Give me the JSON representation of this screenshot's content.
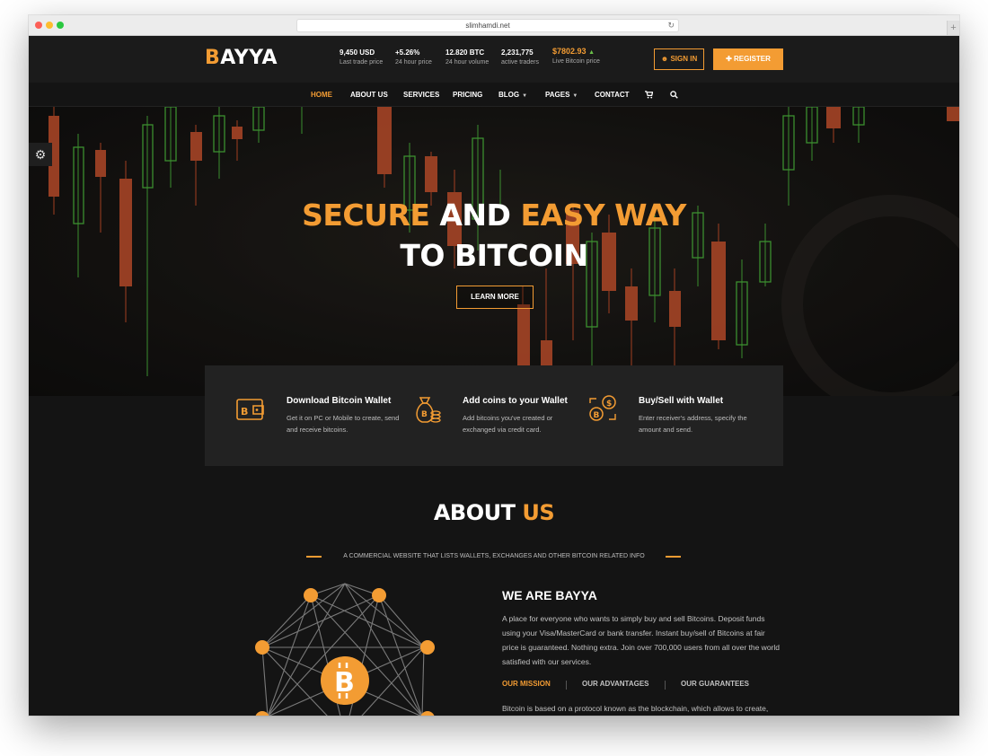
{
  "browser": {
    "url": "slimhamdi.net",
    "reload_icon": "reload-icon"
  },
  "brand": {
    "logo_initial": "B",
    "logo_rest": "AYYA"
  },
  "stats": [
    {
      "value": "9,450 USD",
      "label": "Last trade price"
    },
    {
      "value": "+5.26%",
      "label": "24 hour price"
    },
    {
      "value": "12.820 BTC",
      "label": "24 hour volume"
    },
    {
      "value": "2,231,775",
      "label": "active traders"
    },
    {
      "value": "$7802.93",
      "label": "Live Bitcoin price"
    }
  ],
  "auth": {
    "signin": "SIGN IN",
    "register": "REGISTER"
  },
  "nav": [
    "HOME",
    "ABOUT US",
    "SERVICES",
    "PRICING",
    "BLOG",
    "PAGES",
    "CONTACT"
  ],
  "hero": {
    "line1_a": "SECURE",
    "line1_b": " AND ",
    "line1_c": "EASY WAY",
    "line2": "TO BITCOIN",
    "cta": "LEARN MORE"
  },
  "features": [
    {
      "title": "Download Bitcoin Wallet",
      "desc": "Get it on PC or Mobile to create, send and receive bitcoins.",
      "icon": "wallet-icon"
    },
    {
      "title": "Add coins to your Wallet",
      "desc": "Add bitcoins you've created or exchanged via credit card.",
      "icon": "money-bag-icon"
    },
    {
      "title": "Buy/Sell with Wallet",
      "desc": "Enter receiver's address, specify the amount and send.",
      "icon": "exchange-icon"
    }
  ],
  "about": {
    "title_a": "ABOUT ",
    "title_b": "US",
    "subtitle": "A COMMERCIAL WEBSITE THAT LISTS WALLETS, EXCHANGES AND OTHER BITCOIN RELATED INFO",
    "heading": "WE ARE BAYYA",
    "text": "A place for everyone who wants to simply buy and sell Bitcoins. Deposit funds using your Visa/MasterCard or bank transfer. Instant buy/sell of Bitcoins at fair price is guaranteed. Nothing extra. Join over 700,000 users from all over the world satisfied with our services.",
    "tabs": [
      "OUR MISSION",
      "OUR ADVANTAGES",
      "OUR GUARANTEES"
    ],
    "mission_text": "Bitcoin is based on a protocol known as the blockchain, which allows to create, transfer and verify ultra-secure financial data without interference of third"
  },
  "colors": {
    "accent": "#f39c33",
    "up": "#6cc24a",
    "background": "#141414"
  }
}
